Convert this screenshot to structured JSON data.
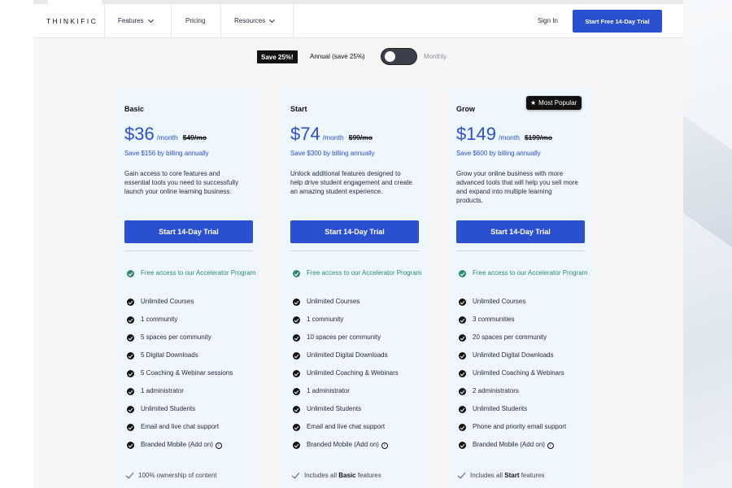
{
  "nav": {
    "logo": "THINKIFIC",
    "features": "Features",
    "pricing": "Pricing",
    "resources": "Resources",
    "sign_in": "Sign In",
    "cta": "Start Free 14-Day Trial"
  },
  "billing": {
    "save_badge": "Save 25%!",
    "annual": "Annual (save 25%)",
    "monthly": "Monthly",
    "annual_selected": true
  },
  "badge_popular": "Most Popular",
  "plans": [
    {
      "name": "Basic",
      "price": "$36",
      "per": "/month",
      "old_price": "$49/mo",
      "savings": "Save $156 by billing annually",
      "description": "Gain access to core features and essential tools you need to successfully launch your online learning business.",
      "button": "Start 14-Day Trial",
      "features": [
        "Free access to our Accelerator Program",
        "Unlimited Courses",
        "1 community",
        "5 spaces per community",
        "5 Digital Downloads",
        "5 Coaching & Webinar sessions",
        "1 administrator",
        "Unlimited Students",
        "Email and live chat support",
        "Branded Mobile (Add on)"
      ],
      "extra_pre": "100% ownership of content",
      "extra_bold": "",
      "extra_post": ""
    },
    {
      "name": "Start",
      "price": "$74",
      "per": "/month",
      "old_price": "$99/mo",
      "savings": "Save $300 by billing annually",
      "description": "Unlock additional features designed to help drive student engagement and create an amazing student experience.",
      "button": "Start 14-Day Trial",
      "features": [
        "Free access to our Accelerator Program",
        "Unlimited Courses",
        "1 community",
        "10 spaces per community",
        "Unlimited Digital Downloads",
        "Unlimited Coaching & Webinars",
        "1 administrator",
        "Unlimited Students",
        "Email and live chat support",
        "Branded Mobile (Add on)"
      ],
      "extra_pre": "Includes all ",
      "extra_bold": "Basic",
      "extra_post": " features"
    },
    {
      "name": "Grow",
      "price": "$149",
      "per": "/month",
      "old_price": "$199/mo",
      "savings": "Save $600 by billing annually",
      "description": "Grow your online business with more advanced tools that will help you sell more and expand into multiple learning products.",
      "button": "Start 14-Day Trial",
      "features": [
        "Free access to our Accelerator Program",
        "Unlimited Courses",
        "3 communities",
        "20 spaces per community",
        "Unlimited Digital Downloads",
        "Unlimited Coaching & Webinars",
        "2 administrators",
        "Unlimited Students",
        "Phone and priority email support",
        "Branded Mobile (Add on)"
      ],
      "extra_pre": "Includes all ",
      "extra_bold": "Start",
      "extra_post": " features"
    }
  ]
}
